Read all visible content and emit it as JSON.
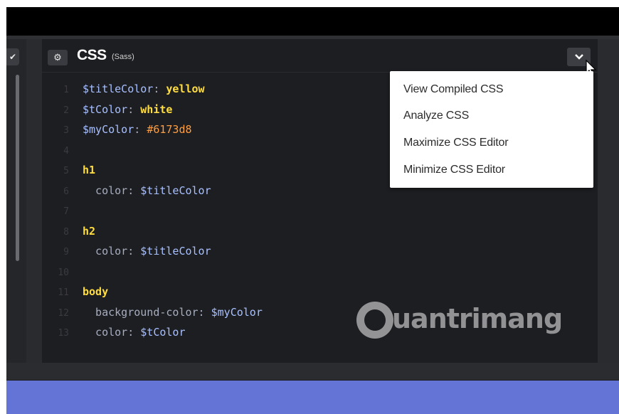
{
  "editor": {
    "title": "CSS",
    "subtitle": "(Sass)",
    "settings_icon": "gear-icon",
    "dropdown_icon": "chevron-down-icon",
    "left_pane_icon": "chevron-down-icon"
  },
  "code_lines": [
    {
      "number": "1",
      "parts": [
        {
          "cls": "var",
          "text": "$titleColor"
        },
        {
          "cls": "prop",
          "text": ": "
        },
        {
          "cls": "kw",
          "text": "yellow"
        }
      ]
    },
    {
      "number": "2",
      "parts": [
        {
          "cls": "var",
          "text": "$tColor"
        },
        {
          "cls": "prop",
          "text": ": "
        },
        {
          "cls": "kw",
          "text": "white"
        }
      ]
    },
    {
      "number": "3",
      "parts": [
        {
          "cls": "var",
          "text": "$myColor"
        },
        {
          "cls": "prop",
          "text": ": "
        },
        {
          "cls": "hex",
          "text": "#6173d8"
        }
      ]
    },
    {
      "number": "4",
      "parts": []
    },
    {
      "number": "5",
      "parts": [
        {
          "cls": "sel",
          "text": "h1"
        }
      ]
    },
    {
      "number": "6",
      "parts": [
        {
          "cls": "prop",
          "text": "  color: "
        },
        {
          "cls": "var",
          "text": "$titleColor"
        }
      ]
    },
    {
      "number": "7",
      "parts": []
    },
    {
      "number": "8",
      "parts": [
        {
          "cls": "sel",
          "text": "h2"
        }
      ]
    },
    {
      "number": "9",
      "parts": [
        {
          "cls": "prop",
          "text": "  color: "
        },
        {
          "cls": "var",
          "text": "$titleColor"
        }
      ]
    },
    {
      "number": "10",
      "parts": []
    },
    {
      "number": "11",
      "parts": [
        {
          "cls": "sel",
          "text": "body"
        }
      ]
    },
    {
      "number": "12",
      "parts": [
        {
          "cls": "prop",
          "text": "  background-color: "
        },
        {
          "cls": "var",
          "text": "$myColor"
        }
      ]
    },
    {
      "number": "13",
      "parts": [
        {
          "cls": "prop",
          "text": "  color: "
        },
        {
          "cls": "var",
          "text": "$tColor"
        }
      ]
    }
  ],
  "menu": {
    "items": [
      {
        "label": "View Compiled CSS"
      },
      {
        "label": "Analyze CSS"
      },
      {
        "label": "Maximize CSS Editor"
      },
      {
        "label": "Minimize CSS Editor"
      }
    ]
  },
  "watermark": {
    "text": "uantrimang"
  },
  "colors": {
    "background": "#1d1e22",
    "accent_blue": "#6474d6",
    "variable": "#a8c0ff",
    "keyword": "#ffdd40",
    "hex_value": "#ff9d3f"
  }
}
